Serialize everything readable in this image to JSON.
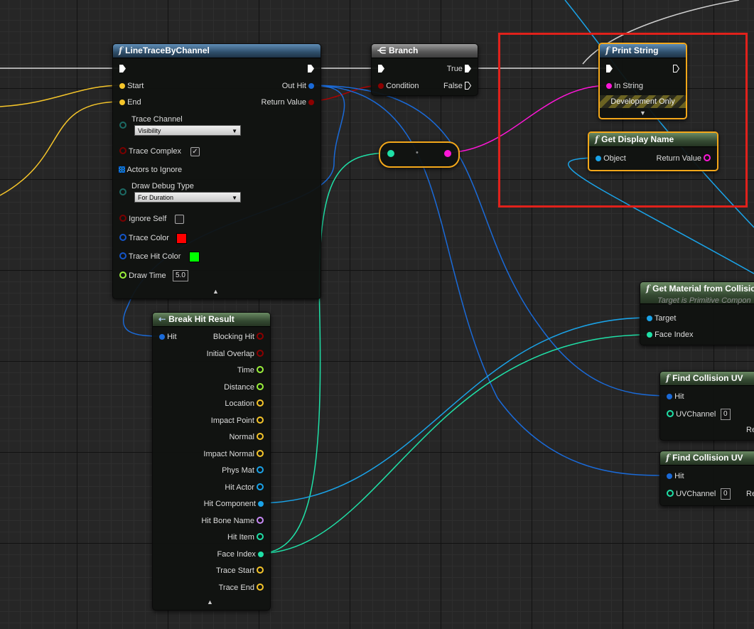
{
  "nodes": {
    "line_trace": {
      "title": "LineTraceByChannel",
      "pins": {
        "start": "Start",
        "end": "End",
        "out_hit": "Out Hit",
        "return_value": "Return Value",
        "trace_channel": "Trace Channel",
        "trace_channel_value": "Visibility",
        "trace_complex": "Trace Complex",
        "actors_to_ignore": "Actors to Ignore",
        "draw_debug_type": "Draw Debug Type",
        "draw_debug_type_value": "For Duration",
        "ignore_self": "Ignore Self",
        "trace_color": "Trace Color",
        "trace_hit_color": "Trace Hit Color",
        "draw_time": "Draw Time",
        "draw_time_value": "5.0"
      },
      "trace_complex_checked": true,
      "ignore_self_checked": false,
      "trace_color": "#ff0000",
      "trace_hit_color": "#00ff00"
    },
    "branch": {
      "title": "Branch",
      "pins": {
        "condition": "Condition",
        "true": "True",
        "false": "False"
      }
    },
    "print_string": {
      "title": "Print String",
      "pins": {
        "in_string": "In String"
      },
      "development_only": "Development Only"
    },
    "get_display_name": {
      "title": "Get Display Name",
      "pins": {
        "object": "Object",
        "return_value": "Return Value"
      }
    },
    "get_material": {
      "title": "Get Material from Collision",
      "subtitle": "Target is Primitive Compon",
      "pins": {
        "target": "Target",
        "face_index": "Face Index"
      }
    },
    "find_uv_1": {
      "title": "Find Collision UV",
      "pins": {
        "hit": "Hit",
        "uv_channel": "UVChannel",
        "uv_channel_value": "0",
        "ret": "Re"
      }
    },
    "find_uv_2": {
      "title": "Find Collision UV",
      "pins": {
        "hit": "Hit",
        "uv_channel": "UVChannel",
        "uv_channel_value": "0",
        "ret": "Re"
      }
    },
    "break_hit": {
      "title": "Break Hit Result",
      "pins": {
        "hit": "Hit",
        "blocking_hit": "Blocking Hit",
        "initial_overlap": "Initial Overlap",
        "time": "Time",
        "distance": "Distance",
        "location": "Location",
        "impact_point": "Impact Point",
        "normal": "Normal",
        "impact_normal": "Impact Normal",
        "phys_mat": "Phys Mat",
        "hit_actor": "Hit Actor",
        "hit_component": "Hit Component",
        "hit_bone_name": "Hit Bone Name",
        "hit_item": "Hit Item",
        "face_index": "Face Index",
        "trace_start": "Trace Start",
        "trace_end": "Trace End"
      }
    }
  },
  "colors": {
    "exec": "#ffffff",
    "bool": "#8c0000",
    "vector": "#f5c52a",
    "struct": "#0a62c6",
    "object": "#1aa3e8",
    "string": "#ff16d8",
    "int": "#1fe0a7",
    "float": "#9cf23b",
    "name": "#c98bf7",
    "linear_color": "#1455c9",
    "selection": "#f3a71a",
    "highlight_box": "#e0211b"
  },
  "icons": {
    "function": "function-icon",
    "branch": "branch-icon",
    "break": "break-struct-icon",
    "array": "array-grid-icon"
  }
}
